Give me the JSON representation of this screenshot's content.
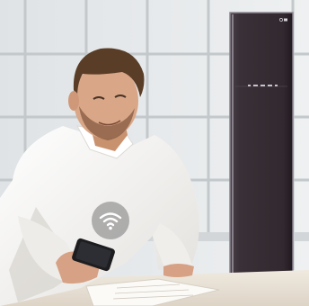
{
  "scene": {
    "subject": "man-with-smartphone",
    "appliance": "styler-cabinet",
    "colors": {
      "background": "#e7eaec",
      "window_frame": "#c9cdcf",
      "shirt": "#f4f2ef",
      "skin": "#d9a788",
      "hair": "#5a3d27",
      "cabinet": "#3b3137",
      "cabinet_edge": "#8d8590",
      "desk": "#ece5d8",
      "phone": "#1d1d1f"
    }
  },
  "wifi_badge": {
    "icon": "wifi-icon"
  }
}
